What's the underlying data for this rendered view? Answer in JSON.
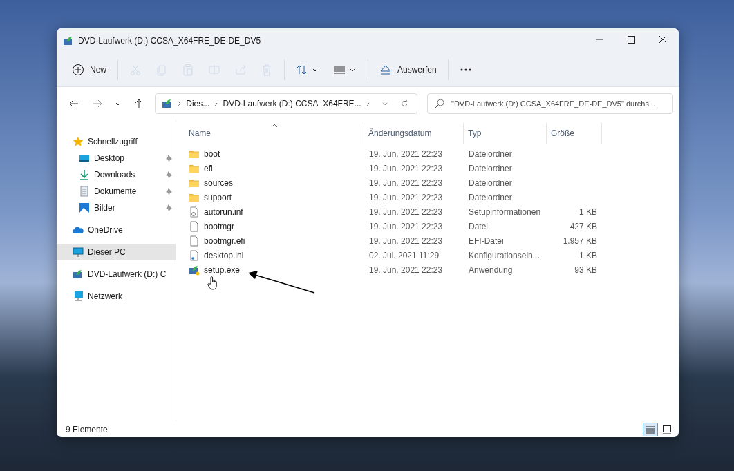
{
  "window": {
    "title": "DVD-Laufwerk (D:) CCSA_X64FRE_DE-DE_DV5"
  },
  "toolbar": [
    {
      "kind": "new",
      "label": "New",
      "disabled": false
    },
    {
      "kind": "cut",
      "disabled": true
    },
    {
      "kind": "copy",
      "disabled": true
    },
    {
      "kind": "paste",
      "disabled": true
    },
    {
      "kind": "rename",
      "disabled": true
    },
    {
      "kind": "share",
      "disabled": true
    },
    {
      "kind": "delete",
      "disabled": true
    },
    {
      "kind": "sort",
      "disabled": false
    },
    {
      "kind": "view",
      "disabled": false
    },
    {
      "kind": "eject",
      "label": "Auswerfen",
      "disabled": false
    },
    {
      "kind": "more",
      "disabled": false
    }
  ],
  "address": {
    "crumbs": [
      "Dies...",
      "DVD-Laufwerk (D:) CCSA_X64FRE..."
    ]
  },
  "search": {
    "placeholder": "\"DVD-Laufwerk (D:) CCSA_X64FRE_DE-DE_DV5\" durchs..."
  },
  "sidebar": {
    "items": [
      {
        "kind": "star",
        "label": "Schnellzugriff",
        "selected": false,
        "children": [
          {
            "kind": "desktop",
            "label": "Desktop",
            "pinned": true,
            "selected": false
          },
          {
            "kind": "download",
            "label": "Downloads",
            "pinned": true,
            "selected": false
          },
          {
            "kind": "document",
            "label": "Dokumente",
            "pinned": true,
            "selected": false
          },
          {
            "kind": "picture",
            "label": "Bilder",
            "pinned": true,
            "selected": false
          }
        ]
      },
      {
        "kind": "cloud",
        "label": "OneDrive",
        "selected": false
      },
      {
        "kind": "pc",
        "label": "Dieser PC",
        "selected": true
      },
      {
        "kind": "dvd",
        "label": "DVD-Laufwerk (D:) C",
        "selected": false
      },
      {
        "kind": "network",
        "label": "Netzwerk",
        "selected": false
      }
    ]
  },
  "table": {
    "columns": [
      "Name",
      "Änderungsdatum",
      "Typ",
      "Größe"
    ],
    "rows": [
      {
        "kind": "folder",
        "name": "boot",
        "date": "19. Jun. 2021 22:23",
        "type": "Dateiordner"
      },
      {
        "kind": "folder",
        "name": "efi",
        "date": "19. Jun. 2021 22:23",
        "type": "Dateiordner"
      },
      {
        "kind": "folder",
        "name": "sources",
        "date": "19. Jun. 2021 22:23",
        "type": "Dateiordner"
      },
      {
        "kind": "folder",
        "name": "support",
        "date": "19. Jun. 2021 22:23",
        "type": "Dateiordner"
      },
      {
        "kind": "settings",
        "name": "autorun.inf",
        "date": "19. Jun. 2021 22:23",
        "type": "Setupinformationen",
        "size": "1 KB"
      },
      {
        "kind": "file",
        "name": "bootmgr",
        "date": "19. Jun. 2021 22:23",
        "type": "Datei",
        "size": "427 KB"
      },
      {
        "kind": "file",
        "name": "bootmgr.efi",
        "date": "19. Jun. 2021 22:23",
        "type": "EFI-Datei",
        "size": "1.957 KB"
      },
      {
        "kind": "ini",
        "name": "desktop.ini",
        "date": "02. Jul. 2021 11:29",
        "type": "Konfigurationsein...",
        "size": "1 KB"
      },
      {
        "kind": "exe",
        "name": "setup.exe",
        "date": "19. Jun. 2021 22:23",
        "type": "Anwendung",
        "size": "93 KB"
      }
    ]
  },
  "status_bar": {
    "count": "9 Elemente",
    "views": [
      {
        "kind": "details",
        "selected": true
      },
      {
        "kind": "tiles",
        "selected": false
      }
    ]
  }
}
